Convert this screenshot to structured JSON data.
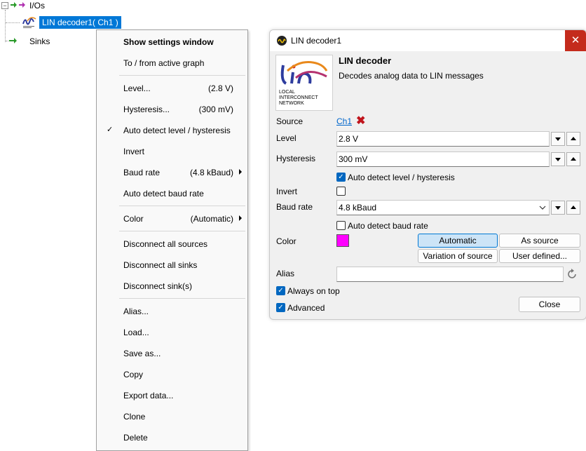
{
  "tree": {
    "root": "I/Os",
    "selected": "LIN decoder1( Ch1 )",
    "sinks": "Sinks"
  },
  "menu": {
    "show_settings": "Show settings window",
    "to_from_graph": "To / from active graph",
    "level": "Level...",
    "level_val": "(2.8 V)",
    "hysteresis": "Hysteresis...",
    "hysteresis_val": "(300 mV)",
    "auto_detect_level": "Auto detect level / hysteresis",
    "invert": "Invert",
    "baud_rate": "Baud rate",
    "baud_rate_val": "(4.8 kBaud)",
    "auto_detect_baud": "Auto detect baud rate",
    "color": "Color",
    "color_val": "(Automatic)",
    "disconnect_sources": "Disconnect all sources",
    "disconnect_sinks": "Disconnect all sinks",
    "disconnect_sink": "Disconnect sink(s)",
    "alias": "Alias...",
    "load": "Load...",
    "save_as": "Save as...",
    "copy": "Copy",
    "export": "Export data...",
    "clone": "Clone",
    "delete": "Delete"
  },
  "dialog": {
    "title": "LIN decoder1",
    "heading": "LIN decoder",
    "description": "Decodes analog data to LIN messages",
    "logo_text": "lin",
    "logo_caption_1": "LOCAL",
    "logo_caption_2": "INTERCONNECT",
    "logo_caption_3": "NETWORK",
    "source_label": "Source",
    "source_value": "Ch1",
    "level_label": "Level",
    "level_value": "2.8 V",
    "hysteresis_label": "Hysteresis",
    "hysteresis_value": "300 mV",
    "auto_detect_level": "Auto detect level / hysteresis",
    "invert_label": "Invert",
    "baud_label": "Baud rate",
    "baud_value": "4.8 kBaud",
    "auto_baud": "Auto detect baud rate",
    "color_label": "Color",
    "btn_automatic": "Automatic",
    "btn_as_source": "As source",
    "btn_variation": "Variation of source",
    "btn_user_defined": "User defined...",
    "alias_label": "Alias",
    "alias_value": "",
    "always_on_top": "Always on top",
    "advanced": "Advanced",
    "close": "Close",
    "swatch_color": "#ff00ff",
    "link_color": "#0066cc"
  }
}
